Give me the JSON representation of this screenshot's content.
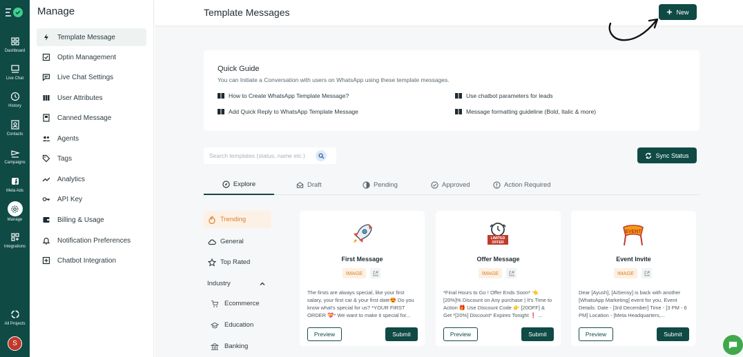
{
  "rail": {
    "items": [
      {
        "label": "Dashboard",
        "icon": "dashboard-icon"
      },
      {
        "label": "Live Chat",
        "icon": "chat-icon"
      },
      {
        "label": "History",
        "icon": "history-icon"
      },
      {
        "label": "Contacts",
        "icon": "contacts-icon"
      },
      {
        "label": "Campaigns",
        "icon": "campaigns-icon"
      },
      {
        "label": "Meta Ads",
        "icon": "meta-icon"
      },
      {
        "label": "Manage",
        "icon": "gear-icon"
      },
      {
        "label": "Integrations",
        "icon": "integrations-icon"
      }
    ],
    "all_projects": "All Projects",
    "avatar_initial": "S"
  },
  "sidebar": {
    "title": "Manage",
    "items": [
      {
        "label": "Template Message"
      },
      {
        "label": "Optin Management"
      },
      {
        "label": "Live Chat Settings"
      },
      {
        "label": "User Attributes"
      },
      {
        "label": "Canned Message"
      },
      {
        "label": "Agents"
      },
      {
        "label": "Tags"
      },
      {
        "label": "Analytics"
      },
      {
        "label": "API Key"
      },
      {
        "label": "Billing & Usage"
      },
      {
        "label": "Notification Preferences"
      },
      {
        "label": "Chatbot Integration"
      }
    ]
  },
  "header": {
    "title": "Template Messages",
    "new_label": "New"
  },
  "guide": {
    "title": "Quick Guide",
    "subtitle": "You can Initiate a Conversation with users on WhatsApp using these template messages.",
    "links": [
      "How to Create WhatsApp Template Message?",
      "Use chatbot parameters for leads",
      "Add Quick Reply to WhatsApp Template Message",
      "Message formatting guideline (Bold, Italic & more)"
    ]
  },
  "search": {
    "placeholder": "Search templates (status, name etc.)"
  },
  "sync_label": "Sync Status",
  "tabs": [
    "Explore",
    "Draft",
    "Pending",
    "Approved",
    "Action Required"
  ],
  "categories": {
    "items": [
      "Trending",
      "General",
      "Top Rated"
    ],
    "industry_label": "Industry",
    "industries": [
      "Ecommerce",
      "Education",
      "Banking"
    ]
  },
  "cards": [
    {
      "title": "First Message",
      "tag": "IMAGE",
      "body": "The firsts are always special, like your first salary, your first car & your first date😍 Do you know what's special for us? *YOUR FIRST ORDER 💝* We want to make it special for..."
    },
    {
      "title": "Offer Message",
      "tag": "IMAGE",
      "body": "*Final Hours to Go ! Offer Ends Soon* 👈 [20%]% Discount on Any purchase | It's Time to Action 🎁 Use Discount Code 👉 [20OFF] & Get *[20%] Discount* Expires Tonight ❗ ..."
    },
    {
      "title": "Event Invite",
      "tag": "IMAGE",
      "body": "Dear [Ayush], [AiSensy] is back with another [WhatsApp Marketing] event for you. Event Details: Date - [3rd December] Time - [3 PM - 6 PM] Location - [Meta Headquarters,..."
    }
  ],
  "card_actions": {
    "preview": "Preview",
    "submit": "Submit"
  },
  "art": {
    "limited_offer_line1": "LIMITED",
    "limited_offer_line2": "OFFER",
    "event_banner": "EVENT"
  },
  "colors": {
    "brand": "#0f4a45",
    "accent": "#d9812b",
    "chat_fab": "#3fa84a"
  }
}
